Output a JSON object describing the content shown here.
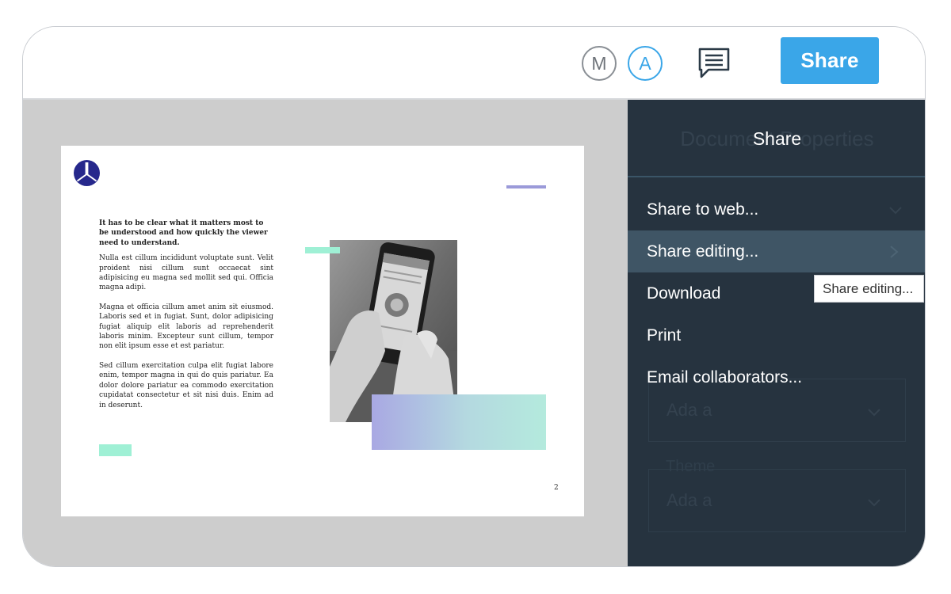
{
  "header": {
    "avatars": [
      {
        "initial": "M",
        "color": "#8a8f95"
      },
      {
        "initial": "A",
        "color": "#3aa6e8"
      }
    ],
    "comments_icon": "comment-icon",
    "share_label": "Share",
    "accent": "#3aa6e8"
  },
  "document": {
    "heading": "It has to be clear what it matters most to be understood and how quickly the viewer need to understand.",
    "paragraphs": [
      "Nulla est cillum incididunt voluptate sunt. Velit proident nisi cillum sunt occaecat sint adipisicing eu magna sed mollit sed qui. Officia magna adipi.",
      "Magna et officia cillum amet anim sit eiusmod. Laboris sed et in fugiat. Sunt, dolor adipisicing fugiat aliquip elit laboris ad reprehenderit laboris minim. Excepteur sunt cillum, tempor non elit ipsum esse et est pariatur.",
      "Sed cillum exercitation culpa elit fugiat labore enim, tempor magna in qui do quis pariatur. Ea dolor dolore pariatur ea commodo exercitation cupidatat consectetur et sit nisi duis. Enim ad in deserunt."
    ],
    "page_number": "2",
    "logo_icon": "brand-logo-icon",
    "photo_icon": "phone-photo"
  },
  "panel": {
    "background": "#26333f",
    "ghost_title": "Document Properties",
    "title": "Share",
    "menu": [
      {
        "label": "Share to web..."
      },
      {
        "label": "Share editing..."
      },
      {
        "label": "Download"
      },
      {
        "label": "Print"
      },
      {
        "label": "Email collaborators..."
      }
    ],
    "ghost_fields": [
      {
        "value": "Ada a"
      },
      {
        "label": "Theme",
        "value": "Ada a"
      }
    ]
  },
  "tooltip": {
    "text": "Share editing..."
  }
}
